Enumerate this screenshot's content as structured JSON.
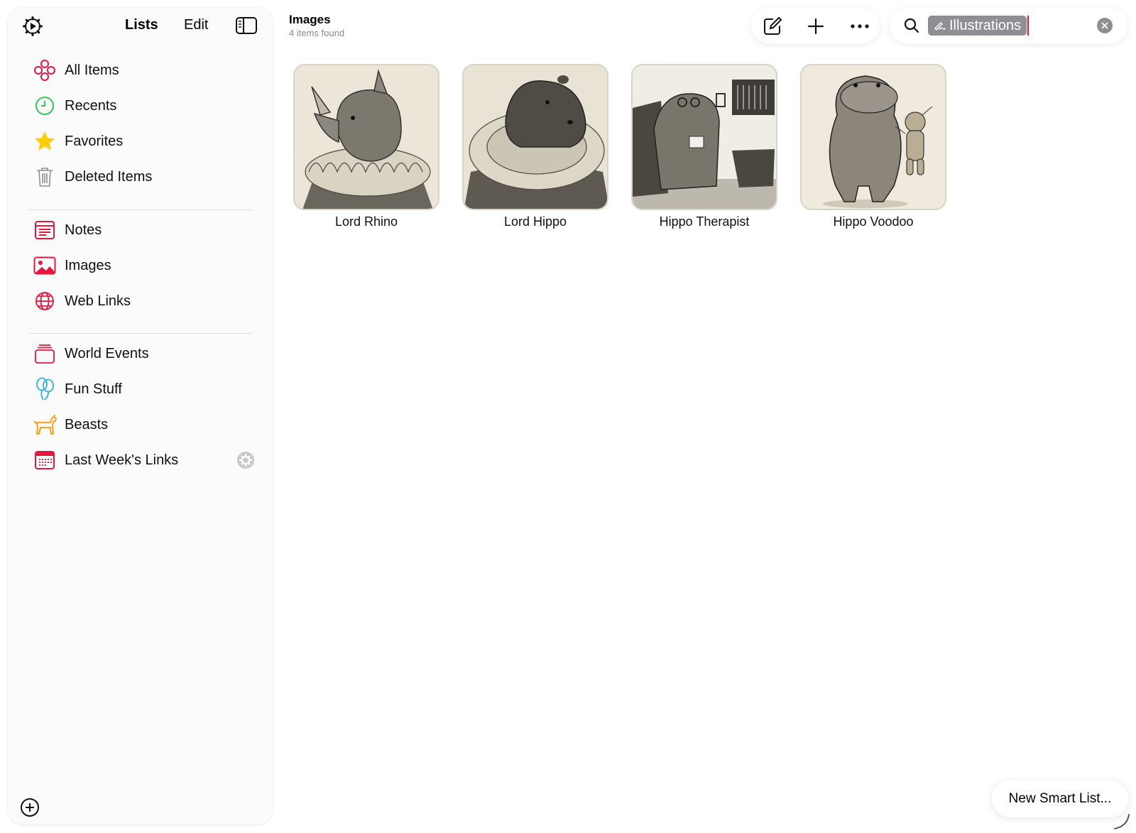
{
  "colors": {
    "accent": "#e5173f",
    "green": "#34c759",
    "star": "#ffcc00",
    "orange": "#ff9500",
    "cyan": "#32ade6",
    "gray": "#8e8e93"
  },
  "sidebar": {
    "tabs": {
      "lists": "Lists",
      "edit": "Edit"
    },
    "groups": [
      [
        {
          "label": "All Items",
          "icon": "all-items-icon"
        },
        {
          "label": "Recents",
          "icon": "clock-icon"
        },
        {
          "label": "Favorites",
          "icon": "star-icon"
        },
        {
          "label": "Deleted Items",
          "icon": "trash-icon"
        }
      ],
      [
        {
          "label": "Notes",
          "icon": "notes-icon"
        },
        {
          "label": "Images",
          "icon": "photo-icon"
        },
        {
          "label": "Web Links",
          "icon": "globe-icon"
        }
      ],
      [
        {
          "label": "World Events",
          "icon": "stack-icon"
        },
        {
          "label": "Fun Stuff",
          "icon": "balloons-icon"
        },
        {
          "label": "Beasts",
          "icon": "dog-icon"
        },
        {
          "label": "Last Week's Links",
          "icon": "calendar-icon",
          "trailing_icon": "gear-icon"
        }
      ]
    ]
  },
  "header": {
    "title": "Images",
    "subtitle": "4 items found"
  },
  "search": {
    "token": "Illustrations",
    "value": ""
  },
  "items": [
    {
      "title": "Lord Rhino"
    },
    {
      "title": "Lord Hippo"
    },
    {
      "title": "Hippo Therapist"
    },
    {
      "title": "Hippo Voodoo"
    }
  ],
  "footer": {
    "new_smart_list": "New Smart List..."
  }
}
